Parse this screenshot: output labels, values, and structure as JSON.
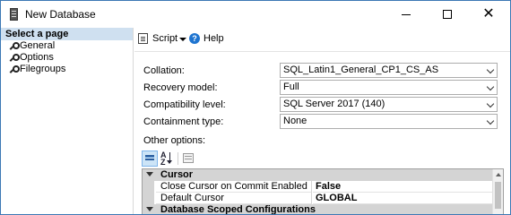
{
  "window": {
    "title": "New Database",
    "close_glyph": "✕"
  },
  "left_pane": {
    "header": "Select a page",
    "pages": [
      {
        "label": "General",
        "icon": "wrench-icon"
      },
      {
        "label": "Options",
        "icon": "wrench-icon"
      },
      {
        "label": "Filegroups",
        "icon": "wrench-icon"
      }
    ]
  },
  "toolbar": {
    "script_label": "Script",
    "help_label": "Help",
    "help_glyph": "?"
  },
  "form": {
    "collation": {
      "label": "Collation:",
      "value": "SQL_Latin1_General_CP1_CS_AS"
    },
    "recovery_model": {
      "label": "Recovery model:",
      "value": "Full"
    },
    "compatibility_level": {
      "label": "Compatibility level:",
      "value": "SQL Server 2017 (140)"
    },
    "containment_type": {
      "label": "Containment type:",
      "value": "None"
    },
    "other_options_label": "Other options:"
  },
  "property_grid": {
    "categories": [
      {
        "name": "Cursor",
        "properties": [
          {
            "name": "Close Cursor on Commit Enabled",
            "value": "False"
          },
          {
            "name": "Default Cursor",
            "value": "GLOBAL"
          }
        ]
      },
      {
        "name": "Database Scoped Configurations",
        "properties": []
      }
    ]
  },
  "colors": {
    "window_border": "#3c78b4",
    "select_header_bg": "#cfe0f0",
    "category_bg": "#d4d4d4",
    "help_icon": "#1e74d0"
  }
}
